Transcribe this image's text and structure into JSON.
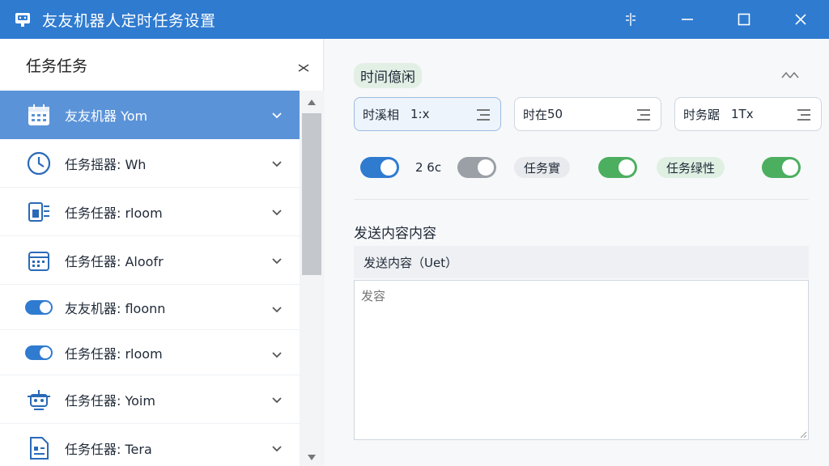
{
  "window": {
    "title": "友友机器人定时任务设置",
    "controls": [
      "pin",
      "minimize",
      "maximize",
      "close"
    ]
  },
  "sidebar": {
    "title": "任务任务",
    "items": [
      {
        "label": "友友机器 Yom",
        "icon": "calendar-icon",
        "active": true
      },
      {
        "label": "任务摇器: Wh",
        "icon": "clock-icon",
        "active": false
      },
      {
        "label": "任务任器: rloom",
        "icon": "document-list-icon",
        "active": false
      },
      {
        "label": "任务任器: Aloofr",
        "icon": "calendar-icon",
        "active": false
      },
      {
        "label": "友友机器: floonn",
        "icon": "toggle-icon",
        "active": false
      },
      {
        "label": "任务任器: rloom",
        "icon": "toggle-icon",
        "active": false
      },
      {
        "label": "任务任器: Yoim",
        "icon": "robot-icon",
        "active": false
      },
      {
        "label": "任务任器: Tera",
        "icon": "document-icon",
        "active": false
      }
    ]
  },
  "main": {
    "section_title": "时间億闲",
    "selects": [
      {
        "label": "时溪相",
        "value": "1:x"
      },
      {
        "label": "时在",
        "value": "50"
      },
      {
        "label": "时务踞",
        "value": "1Tx"
      }
    ],
    "toggles": {
      "t1_state": "on",
      "t1_text": "2 6c",
      "t2_state": "off",
      "chip1": "任务實",
      "t3_state": "on",
      "chip2": "任务绿性",
      "t4_state": "on"
    },
    "content_title": "发送内容内容",
    "content_label": "发送内容（Uet）",
    "textarea_placeholder": "发容"
  },
  "colors": {
    "accent": "#2f7bd0",
    "active_row": "#5b93d8",
    "toggle_on_blue": "#2f7bd0",
    "toggle_on_green": "#4caf60",
    "toggle_off": "#9aa0a6",
    "chip_grey": "#e8eaed",
    "chip_green": "#dff0e3"
  }
}
